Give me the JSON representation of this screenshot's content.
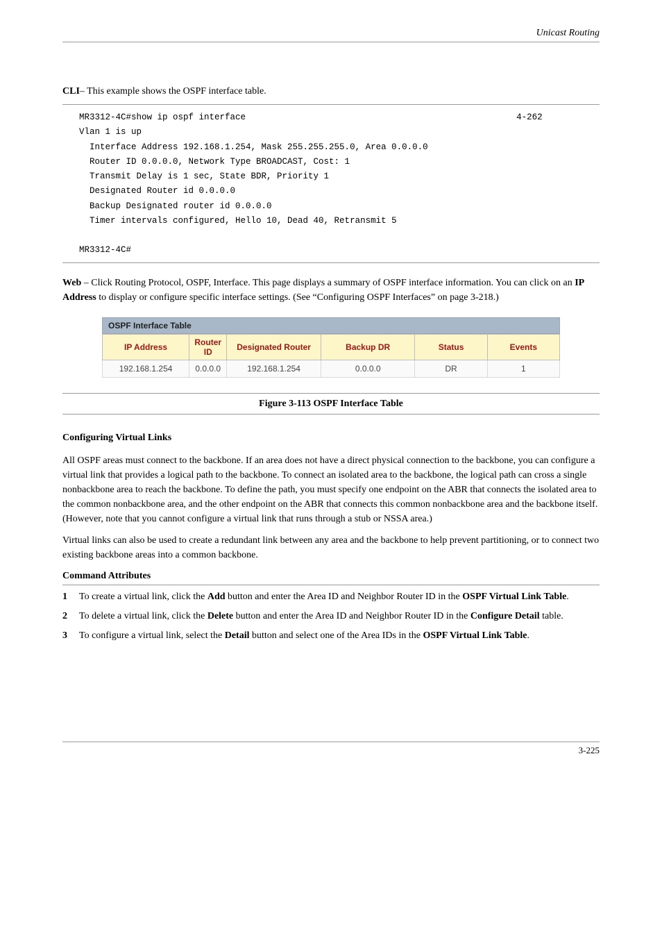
{
  "header": {
    "right": "Unicast Routing"
  },
  "cli": {
    "heading": "CLI",
    "intro": "– This example shows the OSPF interface table.",
    "cmd": "MR3312-4C#show ip ospf interface",
    "out1": "Vlan 1 is up",
    "out2": "  Interface Address 192.168.1.254, Mask 255.255.255.0, Area 0.0.0.0",
    "out3": "  Router ID 0.0.0.0, Network Type BROADCAST, Cost: 1",
    "out4": "  Transmit Delay is 1 sec, State BDR, Priority 1",
    "out5": "  Designated Router id 0.0.0.0",
    "out6": "  Backup Designated router id 0.0.0.0",
    "out7": "  Timer intervals configured, Hello 10, Dead 40, Retransmit 5",
    "out8": "",
    "prompt": "MR3312-4C#",
    "pageref": "4-262"
  },
  "web": {
    "heading": "Web",
    "intro_prefix": " – Click Routing Protocol, OSPF, Interface. This page displays a summary of OSPF interface information. You can click on an ",
    "intro_term": "IP Address",
    "intro_suffix": " to display or configure specific interface settings. (See “Configuring OSPF Interfaces” on page 3-218.)",
    "figure_caption": "Figure 3-113  OSPF Interface Table"
  },
  "ospf_table": {
    "title": "OSPF Interface Table",
    "headers": {
      "ip": "IP Address",
      "rid": "Router ID",
      "dr": "Designated Router",
      "bdr": "Backup DR",
      "status": "Status",
      "events": "Events"
    },
    "row": {
      "ip": "192.168.1.254",
      "rid": "0.0.0.0",
      "dr": "192.168.1.254",
      "bdr": "0.0.0.0",
      "status": "DR",
      "events": "1"
    }
  },
  "vlink": {
    "heading": "Configuring Virtual Links",
    "para": "All OSPF areas must connect to the backbone. If an area does not have a direct physical connection to the backbone, you can configure a virtual link that provides a logical path to the backbone. To connect an isolated area to the backbone, the logical path can cross a single nonbackbone area to reach the backbone. To define the path, you must specify one endpoint on the ABR that connects the isolated area to the common nonbackbone area, and the other endpoint on the ABR that connects this common nonbackbone area and the backbone itself. (However, note that you cannot configure a virtual link that runs through a stub or NSSA area.)",
    "para2": "Virtual links can also be used to create a redundant link between any area and the backbone to help prevent partitioning, or to connect two existing backbone areas into a common backbone.",
    "subhead": "Command Attributes",
    "steps": {
      "s1": {
        "num": "1",
        "text_prefix": "To create a virtual link, click the ",
        "term1": "Add",
        "mid": " button and enter the Area ID and Neighbor Router ID in the ",
        "term2": "OSPF Virtual Link Table",
        "suffix": "."
      },
      "s2": {
        "num": "2",
        "text_prefix": "To delete a virtual link, click the ",
        "term1": "Delete",
        "mid": " button and enter the Area ID and Neighbor Router ID in the ",
        "term2": "Configure Detail",
        "suffix": " table."
      },
      "s3": {
        "num": "3",
        "text_prefix": "To configure a virtual link, select the ",
        "term1": "Detail",
        "mid": " button and select one of the Area IDs in the ",
        "term2": "OSPF Virtual Link Table",
        "suffix": "."
      }
    }
  },
  "footer": {
    "pagenum": "3-225"
  }
}
